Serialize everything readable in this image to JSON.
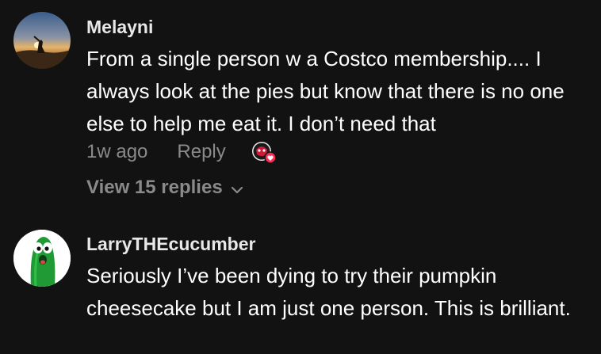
{
  "comments": [
    {
      "username": "Melayni",
      "text": "From a single person w a Costco membership.... I always look at the pies but know that there is no one else to help me eat it. I don’t need that",
      "time": "1w ago",
      "reply_label": "Reply",
      "liked_by_creator_icon": "creator-avatar-heart-badge",
      "view_replies_label": "View 15 replies",
      "avatar_icon": "sunset-photo-avatar"
    },
    {
      "username": "LarryTHEcucumber",
      "text": "Seriously I’ve been dying to try their pumpkin cheesecake but I am just one person. This is brilliant.",
      "avatar_icon": "cucumber-cartoon-avatar"
    }
  ],
  "colors": {
    "background": "#121212",
    "primary_text": "#ffffff",
    "secondary_text": "#8a8a8a",
    "heart_badge": "#fe2c55"
  }
}
